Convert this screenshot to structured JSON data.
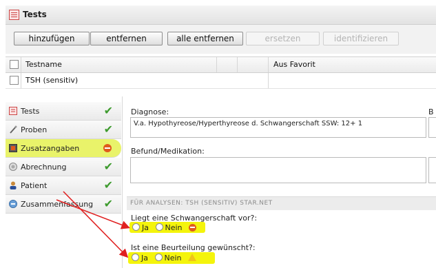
{
  "panel": {
    "title": "Tests"
  },
  "toolbar": {
    "add": "hinzufügen",
    "remove": "entfernen",
    "remove_all": "alle entfernen",
    "replace": "ersetzen",
    "identify": "identifizieren"
  },
  "grid": {
    "columns": [
      "Testname",
      "Aus Favorit"
    ],
    "rows": [
      {
        "testname": "TSH (sensitiv)",
        "from_favorite": ""
      }
    ]
  },
  "nav": {
    "items": [
      {
        "label": "Tests",
        "status": "ok",
        "icon": "tests-icon"
      },
      {
        "label": "Proben",
        "status": "ok",
        "icon": "proben-icon"
      },
      {
        "label": "Zusatzangaben",
        "status": "error",
        "icon": "zusatzangaben-icon"
      },
      {
        "label": "Abrechnung",
        "status": "ok",
        "icon": "abrechnung-icon"
      },
      {
        "label": "Patient",
        "status": "ok",
        "icon": "patient-icon"
      },
      {
        "label": "Zusammenfassung",
        "status": "ok",
        "icon": "zusammenfassung-icon"
      }
    ]
  },
  "form": {
    "diagnose_label": "Diagnose:",
    "diagnose_value": "V.a. Hypothyreose/Hyperthyreose d. Schwangerschaft SSW: 12+ 1",
    "befund_label": "Befund/Medikation:",
    "befund_value": "",
    "right_label_fragment": "B",
    "section_title": "FÜR ANALYSEN: TSH (SENSITIV) STAR.NET",
    "q1": {
      "label": "Liegt eine Schwangerschaft vor?:",
      "yes": "Ja",
      "no": "Nein"
    },
    "q2": {
      "label": "Ist eine Beurteilung gewünscht?:",
      "yes": "Ja",
      "no": "Nein"
    }
  },
  "colors": {
    "highlight": "#f4f40c",
    "check_green": "#3e9b2e",
    "error_orange": "#e05a1c",
    "annotation_arrow": "#e02020"
  }
}
